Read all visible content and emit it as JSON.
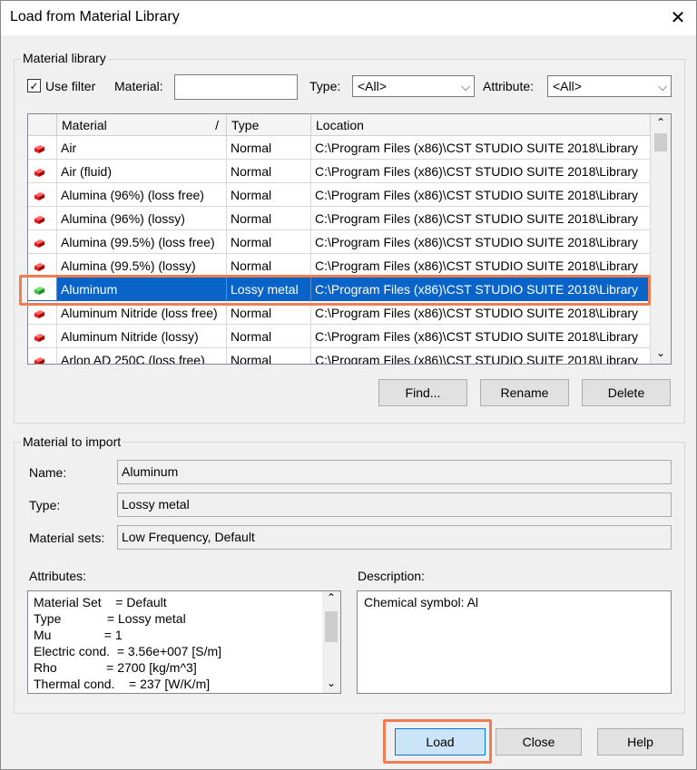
{
  "window": {
    "title": "Load from Material Library"
  },
  "library": {
    "group_label": "Material library",
    "use_filter_label": "Use filter",
    "use_filter_checked": true,
    "material_label": "Material:",
    "material_value": "",
    "type_label": "Type:",
    "type_value": "<All>",
    "attribute_label": "Attribute:",
    "attribute_value": "<All>",
    "columns": {
      "material": "Material",
      "sort_indicator": "/",
      "type": "Type",
      "location": "Location"
    },
    "rows": [
      {
        "material": "Air",
        "type": "Normal",
        "location": "C:\\Program Files (x86)\\CST STUDIO SUITE 2018\\Library",
        "icon": "red-cube-icon",
        "selected": false
      },
      {
        "material": "Air (fluid)",
        "type": "Normal",
        "location": "C:\\Program Files (x86)\\CST STUDIO SUITE 2018\\Library",
        "icon": "red-cube-icon",
        "selected": false
      },
      {
        "material": "Alumina (96%) (loss free)",
        "type": "Normal",
        "location": "C:\\Program Files (x86)\\CST STUDIO SUITE 2018\\Library",
        "icon": "red-cube-icon",
        "selected": false
      },
      {
        "material": "Alumina (96%) (lossy)",
        "type": "Normal",
        "location": "C:\\Program Files (x86)\\CST STUDIO SUITE 2018\\Library",
        "icon": "red-cube-icon",
        "selected": false
      },
      {
        "material": "Alumina (99.5%) (loss free)",
        "type": "Normal",
        "location": "C:\\Program Files (x86)\\CST STUDIO SUITE 2018\\Library",
        "icon": "red-cube-icon",
        "selected": false
      },
      {
        "material": "Alumina (99.5%) (lossy)",
        "type": "Normal",
        "location": "C:\\Program Files (x86)\\CST STUDIO SUITE 2018\\Library",
        "icon": "red-cube-icon",
        "selected": false
      },
      {
        "material": "Aluminum",
        "type": "Lossy metal",
        "location": "C:\\Program Files (x86)\\CST STUDIO SUITE 2018\\Library",
        "icon": "green-cube-icon",
        "selected": true
      },
      {
        "material": "Aluminum Nitride (loss free)",
        "type": "Normal",
        "location": "C:\\Program Files (x86)\\CST STUDIO SUITE 2018\\Library",
        "icon": "red-cube-icon",
        "selected": false
      },
      {
        "material": "Aluminum Nitride (lossy)",
        "type": "Normal",
        "location": "C:\\Program Files (x86)\\CST STUDIO SUITE 2018\\Library",
        "icon": "red-cube-icon",
        "selected": false
      },
      {
        "material": "Arlon AD 250C (loss free)",
        "type": "Normal",
        "location": "C:\\Program Files (x86)\\CST STUDIO SUITE 2018\\Library",
        "icon": "red-cube-icon",
        "selected": false
      }
    ],
    "find_label": "Find...",
    "rename_label": "Rename",
    "delete_label": "Delete"
  },
  "import": {
    "group_label": "Material to import",
    "name_label": "Name:",
    "name_value": "Aluminum",
    "type_label": "Type:",
    "type_value": "Lossy metal",
    "sets_label": "Material sets:",
    "sets_value": "Low Frequency, Default",
    "attributes_label": "Attributes:",
    "attributes_lines": [
      "Material Set    = Default",
      "Type             = Lossy metal",
      "Mu               = 1",
      "Electric cond.  = 3.56e+007 [S/m]",
      "Rho              = 2700 [kg/m^3]",
      "Thermal cond.    = 237 [W/K/m]"
    ],
    "description_label": "Description:",
    "description_value": "Chemical symbol: Al"
  },
  "footer": {
    "load_label": "Load",
    "close_label": "Close",
    "help_label": "Help"
  },
  "colors": {
    "selection": "#0a64c8",
    "highlight": "#f07c54",
    "default_button": "#cce4f7"
  }
}
